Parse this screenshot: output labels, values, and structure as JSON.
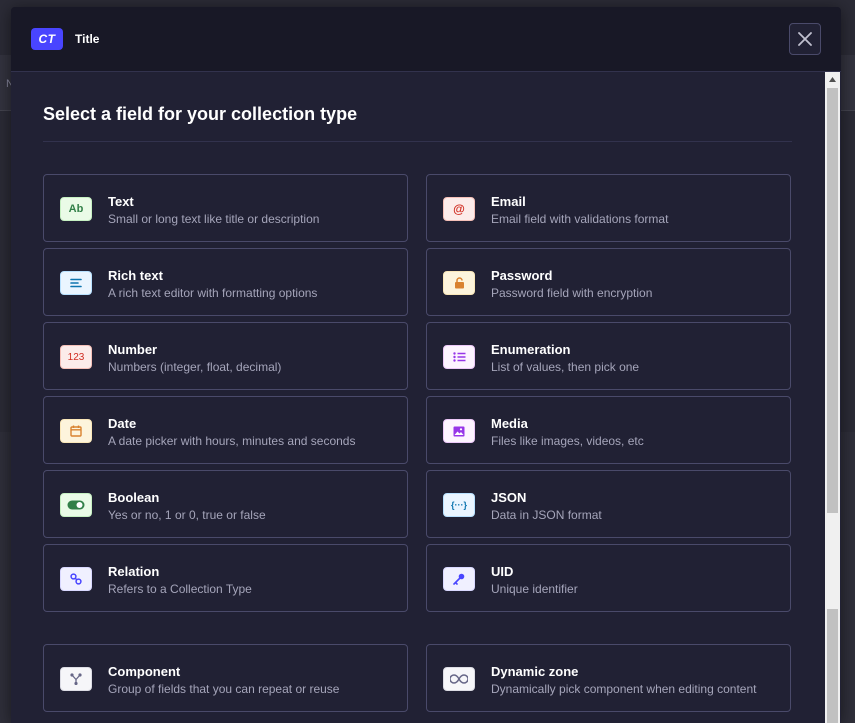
{
  "background": {
    "fragment_text": "N"
  },
  "header": {
    "badge": "CT",
    "title": "Title"
  },
  "section": {
    "title": "Select a field for your collection type"
  },
  "fields": [
    {
      "title": "Text",
      "description": "Small or long text like title or description",
      "icon": "text-icon",
      "icon_text": "Ab",
      "color": "#328048",
      "bg": "#eafbe7",
      "border": "#c6f0c2"
    },
    {
      "title": "Email",
      "description": "Email field with validations format",
      "icon": "email-icon",
      "icon_text": "@",
      "color": "#d02b20",
      "bg": "#fcecea",
      "border": "#f5c0b8"
    },
    {
      "title": "Rich text",
      "description": "A rich text editor with formatting options",
      "icon": "richtext-icon",
      "icon_text": "",
      "color": "#0c75af",
      "bg": "#eaf5ff",
      "border": "#b8e1ff"
    },
    {
      "title": "Password",
      "description": "Password field with encryption",
      "icon": "lock-icon",
      "icon_text": "",
      "color": "#d9822f",
      "bg": "#fdf4dc",
      "border": "#fae7b9"
    },
    {
      "title": "Number",
      "description": "Numbers (integer, float, decimal)",
      "icon": "number-icon",
      "icon_text": "123",
      "color": "#d02b20",
      "bg": "#fcecea",
      "border": "#f5c0b8"
    },
    {
      "title": "Enumeration",
      "description": "List of values, then pick one",
      "icon": "list-icon",
      "icon_text": "",
      "color": "#9736e8",
      "bg": "#fdf4ff",
      "border": "#ecc8f8"
    },
    {
      "title": "Date",
      "description": "A date picker with hours, minutes and seconds",
      "icon": "calendar-icon",
      "icon_text": "",
      "color": "#d9822f",
      "bg": "#fdf4dc",
      "border": "#fae7b9"
    },
    {
      "title": "Media",
      "description": "Files like images, videos, etc",
      "icon": "image-icon",
      "icon_text": "",
      "color": "#9736e8",
      "bg": "#fdf4ff",
      "border": "#ecc8f8"
    },
    {
      "title": "Boolean",
      "description": "Yes or no, 1 or 0, true or false",
      "icon": "toggle-icon",
      "icon_text": "",
      "color": "#328048",
      "bg": "#eafbe7",
      "border": "#c6f0c2"
    },
    {
      "title": "JSON",
      "description": "Data in JSON format",
      "icon": "json-icon",
      "icon_text": "{···}",
      "color": "#0c75af",
      "bg": "#eaf5ff",
      "border": "#b8e1ff"
    },
    {
      "title": "Relation",
      "description": "Refers to a Collection Type",
      "icon": "link-icon",
      "icon_text": "",
      "color": "#4945ff",
      "bg": "#f0f0ff",
      "border": "#d9d8ff"
    },
    {
      "title": "UID",
      "description": "Unique identifier",
      "icon": "key-icon",
      "icon_text": "",
      "color": "#4945ff",
      "bg": "#f0f0ff",
      "border": "#d9d8ff"
    },
    {
      "title": "Component",
      "description": "Group of fields that you can repeat or reuse",
      "icon": "component-icon",
      "icon_text": "",
      "color": "#666687",
      "bg": "#f6f6f9",
      "border": "#dcdce4"
    },
    {
      "title": "Dynamic zone",
      "description": "Dynamically pick component when editing content",
      "icon": "infinity-icon",
      "icon_text": "",
      "color": "#666687",
      "bg": "#f6f6f9",
      "border": "#dcdce4"
    }
  ]
}
